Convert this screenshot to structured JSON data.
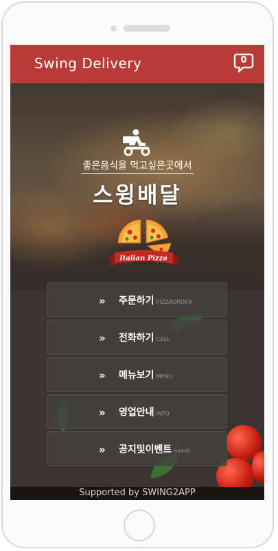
{
  "header": {
    "title": "Swing  Delivery",
    "message_count": "0"
  },
  "hero": {
    "slogan": "좋은음식을 먹고싶은곳에서",
    "brand_name": "스윙배달",
    "logo_text": "Italian Pizza"
  },
  "menu": {
    "items": [
      {
        "arrow": "»",
        "label": "주문하기",
        "sub": "PIZZAORDER"
      },
      {
        "arrow": "»",
        "label": "전화하기",
        "sub": "CALL"
      },
      {
        "arrow": "»",
        "label": "메뉴보기",
        "sub": "MENU"
      },
      {
        "arrow": "»",
        "label": "영업안내",
        "sub": "INFO"
      },
      {
        "arrow": "»",
        "label": "공지및이벤트",
        "sub": "event"
      }
    ]
  },
  "footer": {
    "text": "Supported by SWING2APP"
  },
  "colors": {
    "header": "#b93a36",
    "menu_button": "#464240",
    "footer": "#1a1410"
  },
  "icons": [
    "delivery-rider-icon",
    "chat-bubble-icon",
    "pizza-logo-icon",
    "double-chevron-right-icon"
  ]
}
